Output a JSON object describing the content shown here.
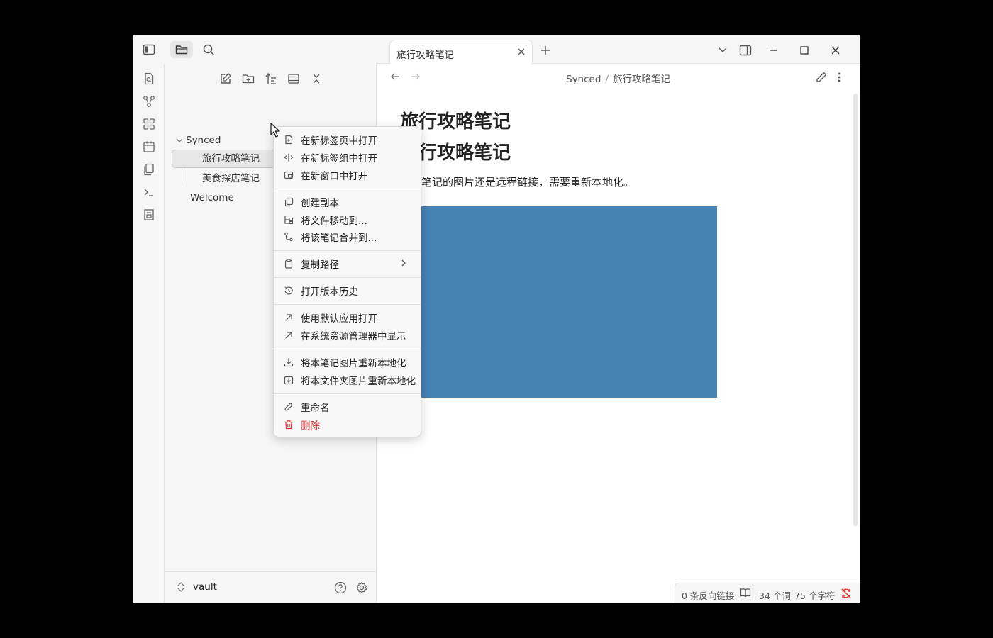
{
  "window": {
    "tab_title": "旅行攻略笔记",
    "accent_color": "#7c5cff"
  },
  "explorer": {
    "folder": "Synced",
    "files": [
      "旅行攻略笔记",
      "美食探店笔记"
    ],
    "root_file": "Welcome",
    "vault": "vault"
  },
  "breadcrumb": {
    "folder": "Synced",
    "sep": "/",
    "note": "旅行攻略笔记"
  },
  "note": {
    "h1": "旅行攻略笔记",
    "h1b": "旅行攻略笔记",
    "para": "这篇笔记的图片还是远程链接，需要重新本地化。",
    "image_color": "#4682b4"
  },
  "status": {
    "backlinks": "0 条反向链接",
    "words": "34 个词",
    "chars": "75 个字符"
  },
  "context_menu": {
    "items": [
      {
        "label": "在新标签页中打开",
        "icon": "new-tab-icon"
      },
      {
        "label": "在新标签组中打开",
        "icon": "split-icon"
      },
      {
        "label": "在新窗口中打开",
        "icon": "window-icon"
      },
      {
        "label": "创建副本",
        "icon": "copy-icon"
      },
      {
        "label": "将文件移动到...",
        "icon": "move-icon"
      },
      {
        "label": "将该笔记合并到...",
        "icon": "merge-icon"
      },
      {
        "label": "复制路径",
        "icon": "clipboard-icon"
      },
      {
        "label": "打开版本历史",
        "icon": "history-icon"
      },
      {
        "label": "使用默认应用打开",
        "icon": "external-link-icon"
      },
      {
        "label": "在系统资源管理器中显示",
        "icon": "external-link-icon"
      },
      {
        "label": "将本笔记图片重新本地化",
        "icon": "download-icon"
      },
      {
        "label": "将本文件夹图片重新本地化",
        "icon": "folder-download-icon"
      },
      {
        "label": "重命名",
        "icon": "pencil-icon"
      },
      {
        "label": "删除",
        "icon": "trash-icon"
      }
    ]
  }
}
